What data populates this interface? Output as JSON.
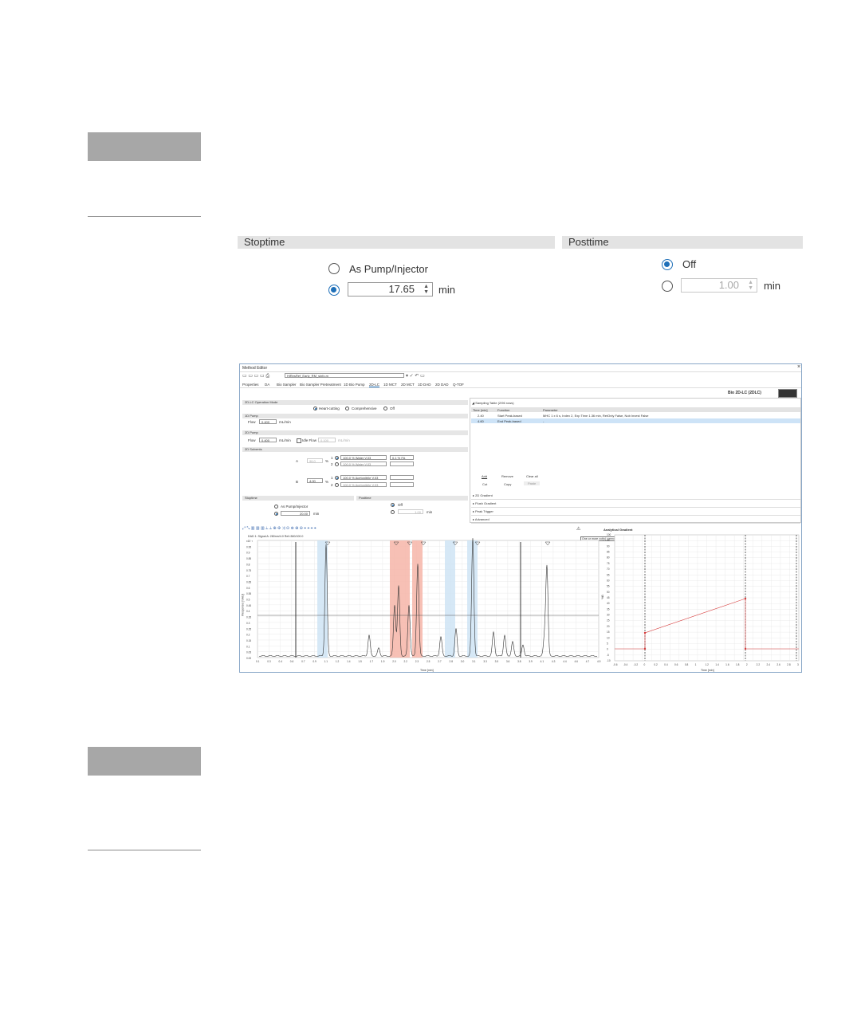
{
  "stoptime": {
    "header": "Stoptime",
    "option_as_pump": "As Pump/Injector",
    "value": "17.65",
    "unit": "min",
    "selected": "value"
  },
  "posttime": {
    "header": "Posttime",
    "option_off": "Off",
    "value": "1.00",
    "unit": "min",
    "selected": "off"
  },
  "method_editor": {
    "title": "Method Editor",
    "close": "×",
    "filename": "HiResRef_Early_RM_sinfo.m",
    "brand": "Bio 2D-LC (2DLC)",
    "tabs": [
      "Properties",
      "DA",
      "Bio Sampler",
      "Bio Sampler Pretreatment",
      "1D Bio Pump",
      "2D-LC",
      "1D MCT",
      "2D MCT",
      "1D DAD",
      "2D DAD",
      "Q-TOF"
    ],
    "op_mode": {
      "header": "2D-LC Operation Mode",
      "options": [
        "Heart-cutting",
        "Comprehensive",
        "Off"
      ]
    },
    "pump1": {
      "header": "1D Pump",
      "flow_label": "Flow",
      "flow": "0.400",
      "unit": "mL/min"
    },
    "pump2": {
      "header": "2D Pump",
      "flow_label": "Flow",
      "flow": "0.400",
      "unit": "mL/min",
      "idle_label": "Idle Flow",
      "idle_value": "0.100"
    },
    "solvents": {
      "header": "2D Solvents",
      "a_label": "A",
      "a_value": "96.0",
      "b_label": "B",
      "b_value": "4.00",
      "pct": "%",
      "a1": "100.0 % Water V.03",
      "a1_extra": "0.1 % FA",
      "a2": "100.0 % Water V.03",
      "b1": "100.0 % Acetonitrile V.03",
      "b2": "100.0 % Acetonitrile V.03",
      "ch1": "1",
      "ch2": "2"
    },
    "stop": {
      "header": "Stoptime",
      "opt": "As Pump/Injector",
      "value": "20.00",
      "unit": "min"
    },
    "post": {
      "header": "Posttime",
      "opt": "Off",
      "value": "1.00",
      "unit": "min"
    },
    "sampling": {
      "header": "Sampling Table (2/96 rows)",
      "cols": [
        "Time [min]",
        "Function",
        "Parameter"
      ],
      "rows": [
        {
          "time": "2.40",
          "function": "Start Peak-based",
          "param": "MHC 1 x 6 s, Index 2, Exp Time 1.36 min, RetOnly False, Nob Invest False"
        },
        {
          "time": "4.60",
          "function": "End Peak-based",
          "param": "-"
        }
      ],
      "buttons": [
        "Add",
        "Remove",
        "Clear all",
        "Cut",
        "Copy",
        "Paste"
      ]
    },
    "collapsibles": [
      "2D Gradient",
      "Flush Gradient",
      "Peak Trigger",
      "Advanced"
    ],
    "chart_title": "DAD 1: Signal A: 280nm/4.0 Ref=360/100.0",
    "ylabel": "Response [mAU]",
    "xlabel": "Time [min]",
    "gradient_title": "Analytical Gradient",
    "gradient_tooltip": "One or more cut(s) cannot be analyzed within the defined run time.",
    "gradient_ylabel": "%B",
    "gradient_xlabel": "Time [min]",
    "warn_icon": "warning-triangle-icon"
  }
}
